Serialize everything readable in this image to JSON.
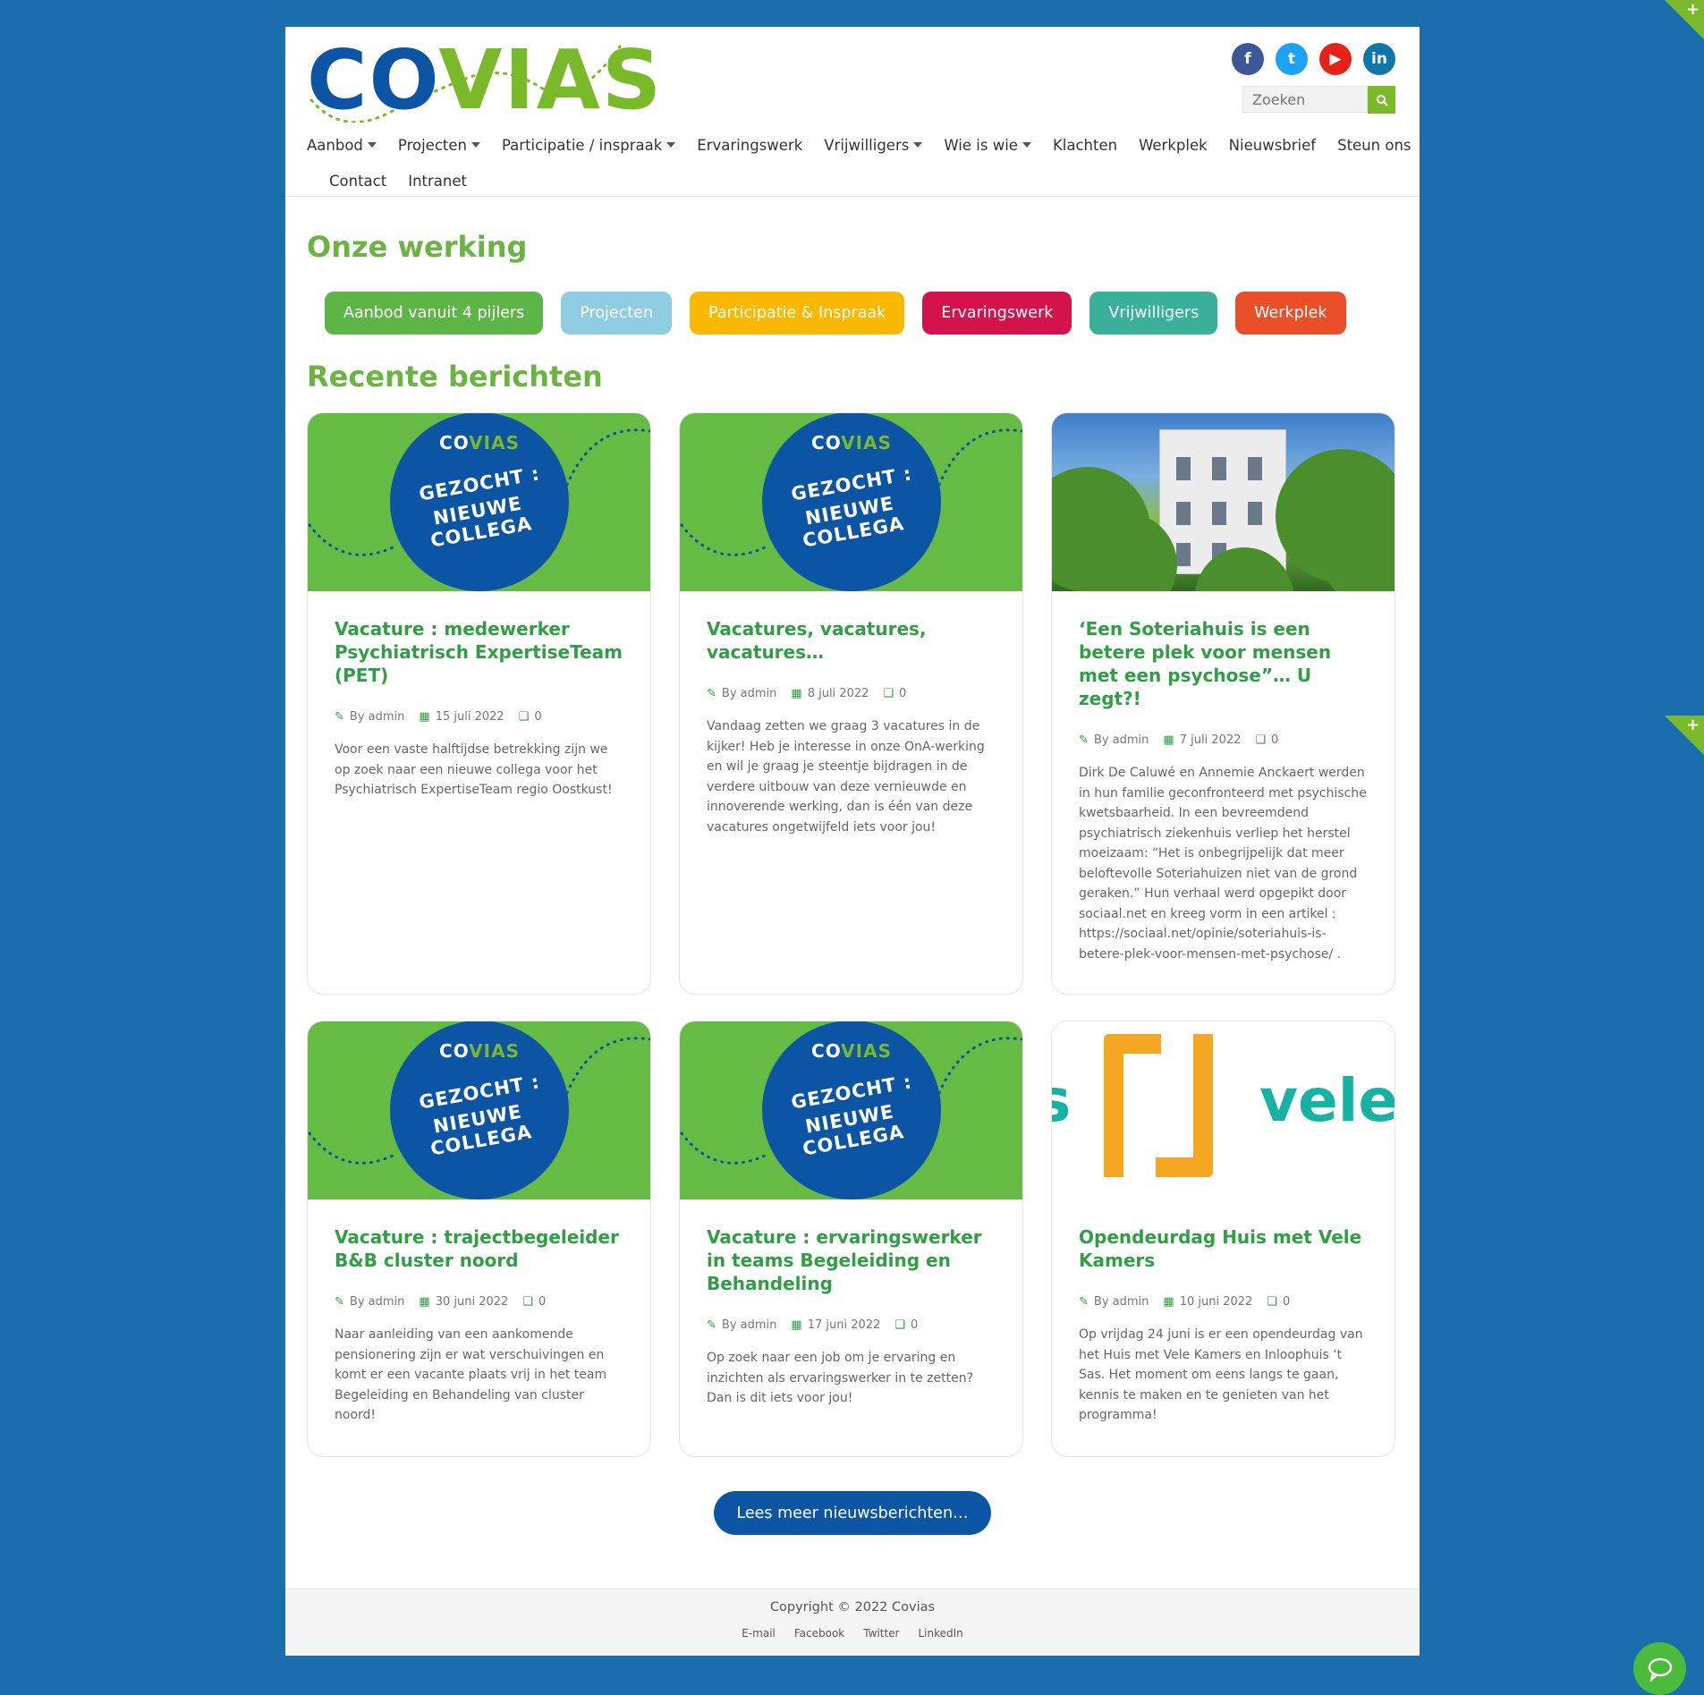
{
  "brand": {
    "logo_text_a": "CO",
    "logo_text_b": "VIAS"
  },
  "social": [
    {
      "name": "facebook-icon",
      "glyph": "f",
      "color": "#3b5998"
    },
    {
      "name": "twitter-icon",
      "glyph": "t",
      "color": "#1da1f2"
    },
    {
      "name": "youtube-icon",
      "glyph": "▶",
      "color": "#e62117"
    },
    {
      "name": "linkedin-icon",
      "glyph": "in",
      "color": "#0e76a8"
    }
  ],
  "search": {
    "placeholder": "Zoeken"
  },
  "nav": {
    "row1": [
      {
        "label": "Aanbod",
        "dropdown": true
      },
      {
        "label": "Projecten",
        "dropdown": true
      },
      {
        "label": "Participatie / inspraak",
        "dropdown": true
      },
      {
        "label": "Ervaringswerk",
        "dropdown": false
      },
      {
        "label": "Vrijwilligers",
        "dropdown": true
      },
      {
        "label": "Wie is wie",
        "dropdown": true
      },
      {
        "label": "Klachten",
        "dropdown": false
      },
      {
        "label": "Werkplek",
        "dropdown": false
      },
      {
        "label": "Nieuwsbrief",
        "dropdown": false
      },
      {
        "label": "Steun ons",
        "dropdown": false
      }
    ],
    "row2": [
      {
        "label": "Contact"
      },
      {
        "label": "Intranet"
      }
    ]
  },
  "section_werking": "Onze werking",
  "pillars": [
    {
      "label": "Aanbod vanuit 4 pijlers",
      "color": "#5db548"
    },
    {
      "label": "Projecten",
      "color": "#8fcde3"
    },
    {
      "label": "Participatie & Inspraak",
      "color": "#fbb800"
    },
    {
      "label": "Ervaringswerk",
      "color": "#d4124c"
    },
    {
      "label": "Vrijwilligers",
      "color": "#3aaf99"
    },
    {
      "label": "Werkplek",
      "color": "#e9502a"
    }
  ],
  "section_recent": "Recente berichten",
  "vacancy_image": {
    "brand_a": "CO",
    "brand_b": "VIAS",
    "line1": "GEZOCHT :",
    "line2": "NIEUWE COLLEGA"
  },
  "posts": [
    {
      "title": "Vacature : medewerker Psychiatrisch ExpertiseTeam (PET)",
      "author": "By admin",
      "date": "15 juli 2022",
      "comments": "0",
      "excerpt": "Voor een vaste halftijdse betrekking zijn we op zoek naar een nieuwe collega voor het Psychiatrisch ExpertiseTeam regio Oostkust!",
      "image": "vacancy"
    },
    {
      "title": "Vacatures, vacatures, vacatures…",
      "author": "By admin",
      "date": "8 juli 2022",
      "comments": "0",
      "excerpt": "Vandaag zetten we graag 3 vacatures in de kijker! Heb je interesse in onze OnA-werking en wil je graag je steentje bijdragen in de verdere uitbouw van deze vernieuwde en innoverende werking, dan is één van deze vacatures ongetwijfeld iets voor jou!",
      "image": "vacancy"
    },
    {
      "title": "‘Een Soteriahuis is een betere plek voor mensen met een psychose”… U zegt?!",
      "author": "By admin",
      "date": "7 juli 2022",
      "comments": "0",
      "excerpt": "Dirk De Caluwé en Annemie Anckaert werden in hun familie geconfronteerd met psychische kwetsbaarheid. In een bevreemdend psychiatrisch ziekenhuis verliep het herstel moeizaam: “Het is onbegrijpelijk dat meer beloftevolle Soteriahuizen niet van de grond geraken.” Hun verhaal werd opgepikt door sociaal.net en kreeg vorm in een artikel : https://sociaal.net/opinie/soteriahuis-is-betere-plek-voor-mensen-met-psychose/ .",
      "image": "photo"
    },
    {
      "title": "Vacature : trajectbegeleider B&B cluster noord",
      "author": "By admin",
      "date": "30 juni 2022",
      "comments": "0",
      "excerpt": "Naar aanleiding van een aankomende pensionering zijn er wat verschuivingen en komt er een vacante plaats vrij in het team Begeleiding en Behandeling van cluster noord!",
      "image": "vacancy"
    },
    {
      "title": "Vacature : ervaringswerker in teams Begeleiding en Behandeling",
      "author": "By admin",
      "date": "17 juni 2022",
      "comments": "0",
      "excerpt": "Op zoek naar een job om je ervaring en inzichten als ervaringswerker in te zetten? Dan is dit iets voor jou!",
      "image": "vacancy"
    },
    {
      "title": "Opendeurdag Huis met Vele Kamers",
      "author": "By admin",
      "date": "10 juni 2022",
      "comments": "0",
      "excerpt": "Op vrijdag 24 juni is er een opendeurdag van het Huis met Vele Kamers en Inloophuis ‘t Sas. Het moment om eens langs te gaan, kennis te maken en te genieten van het programma!",
      "image": "logo",
      "logo_left": "s",
      "logo_right": "vele"
    }
  ],
  "more_button": "Lees meer nieuwsberichten…",
  "footer": {
    "copyright": "Copyright © 2022 Covias",
    "links": [
      "E-mail",
      "Facebook",
      "Twitter",
      "LinkedIn"
    ]
  },
  "icons": {
    "author": "pencil-icon",
    "date": "calendar-icon",
    "comments": "comments-icon",
    "search": "search-icon",
    "chat": "chat-icon",
    "expand": "plus-icon"
  }
}
